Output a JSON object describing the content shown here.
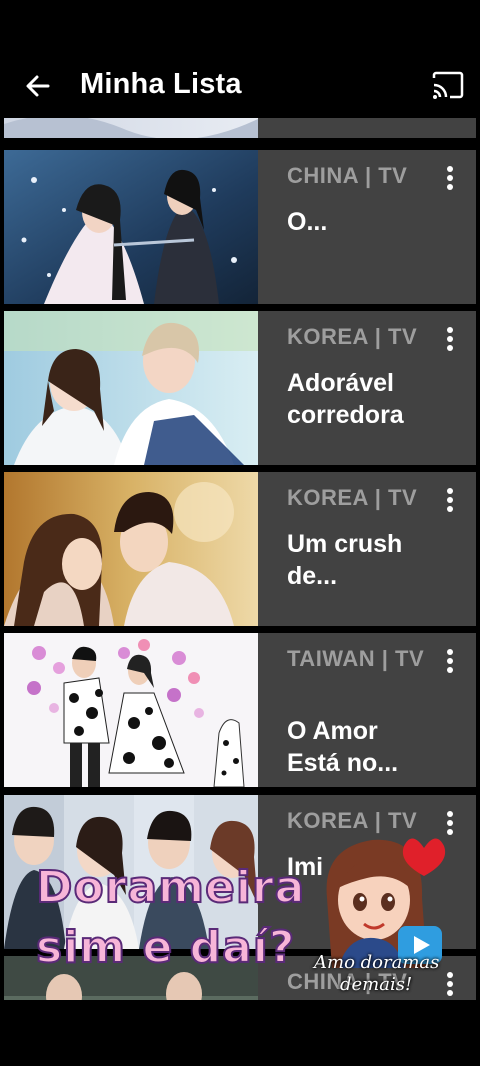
{
  "app_bar": {
    "title": "Minha Lista",
    "back_icon": "arrow-left-icon",
    "cast_icon": "cast-icon"
  },
  "items": [
    {
      "meta": "CHINA | TV",
      "title": "O..."
    },
    {
      "meta": "KOREA | TV",
      "title": "Adorável corredora"
    },
    {
      "meta": "KOREA | TV",
      "title": "Um crush de..."
    },
    {
      "meta": "TAIWAN | TV",
      "title": "O Amor Está no..."
    },
    {
      "meta": "KOREA | TV",
      "title": "Imi"
    },
    {
      "meta": "CHINA | TV",
      "title": ""
    }
  ],
  "overlay": {
    "line1": "Dorameira",
    "line2": "sim e daí?",
    "signature_line1": "Amo doramas",
    "signature_line2": "demais!"
  },
  "colors": {
    "background": "#000000",
    "card": "#424242",
    "meta_text": "#9e9e9e",
    "title_text": "#ffffff"
  }
}
